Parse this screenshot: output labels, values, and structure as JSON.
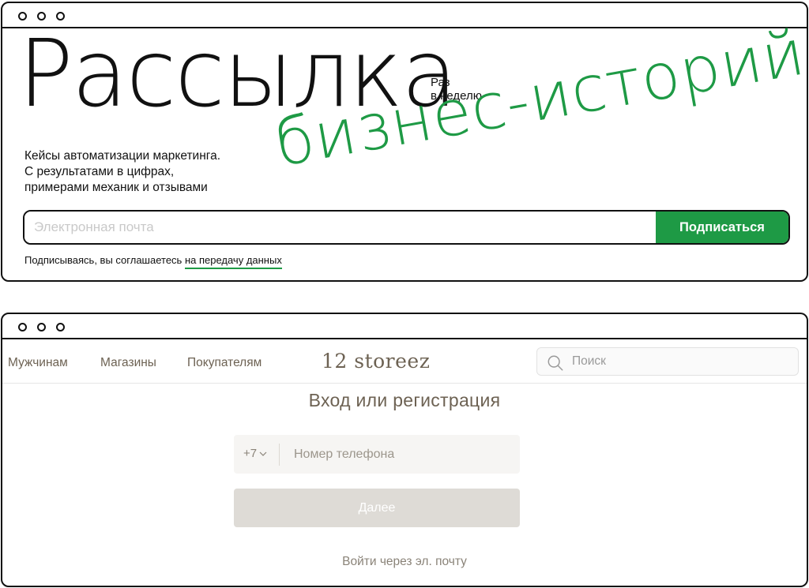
{
  "newsletter": {
    "title": "Рассылка",
    "frequency_line1": "Раз",
    "frequency_line2": "в неделю",
    "script_title": "бизнес-историй",
    "description_line1": "Кейсы автоматизации маркетинга.",
    "description_line2": "С результатами в цифрах,",
    "description_line3": "примерами механик и отзывами",
    "email_placeholder": "Электронная почта",
    "email_value": "",
    "subscribe_label": "Подписаться",
    "consent_text": "Подписываясь, вы соглашаетесь ",
    "consent_link": "на передачу данных",
    "accent_color": "#1e9a45"
  },
  "store": {
    "nav_items": [
      "Мужчинам",
      "Магазины",
      "Покупателям"
    ],
    "logo": "12 storeez",
    "search_placeholder": "Поиск",
    "login_title": "Вход или регистрация",
    "country_code": "+7",
    "phone_placeholder": "Номер телефона",
    "next_label": "Далее",
    "email_login_label": "Войти через эл. почту",
    "brand_color": "#6d6253"
  }
}
